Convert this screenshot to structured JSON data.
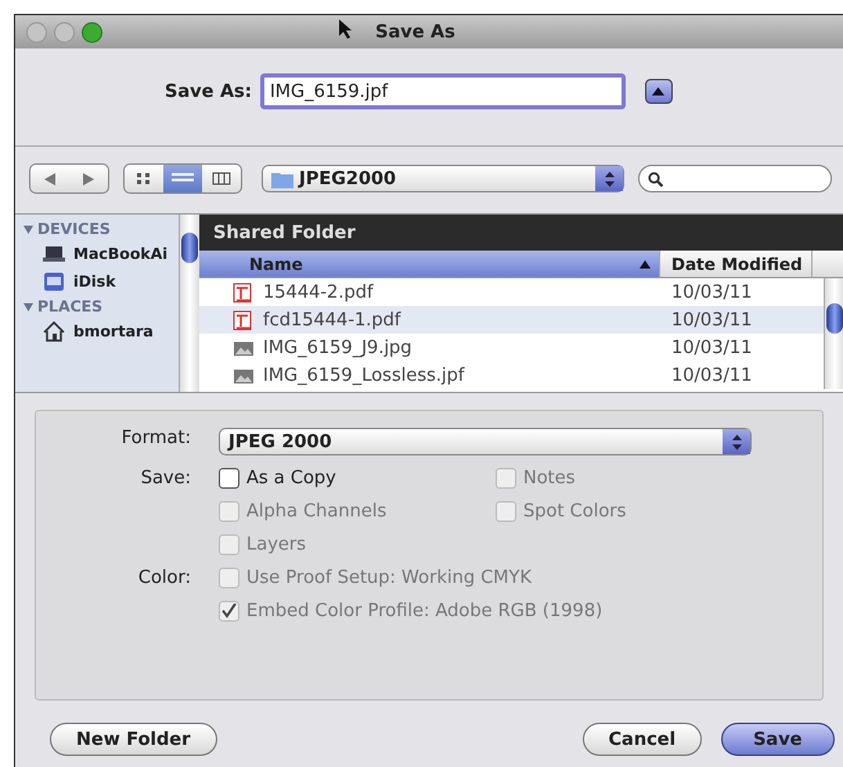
{
  "window": {
    "title": "Save As"
  },
  "save_as": {
    "label": "Save As:",
    "value": "IMG_6159.jpf",
    "expanded": false
  },
  "toolbar": {
    "views": [
      {
        "kind": "icon",
        "selected": false
      },
      {
        "kind": "list",
        "selected": true
      },
      {
        "kind": "column",
        "selected": false
      }
    ],
    "location": "JPEG2000"
  },
  "sidebar": {
    "sections": [
      {
        "title": "DEVICES",
        "items": [
          {
            "kind": "laptop",
            "label": "MacBookAi"
          },
          {
            "kind": "disk",
            "label": "iDisk"
          }
        ]
      },
      {
        "title": "PLACES",
        "items": [
          {
            "kind": "home",
            "label": "bmortara"
          }
        ]
      }
    ]
  },
  "browser": {
    "folder": "Shared Folder",
    "columns": [
      {
        "label": "Name",
        "sorted": true
      },
      {
        "label": "Date Modified",
        "sorted": false
      }
    ],
    "rows": [
      {
        "kind": "pdf",
        "name": "15444-2.pdf",
        "date": "10/03/11",
        "selected": false
      },
      {
        "kind": "pdf",
        "name": "fcd15444-1.pdf",
        "date": "10/03/11",
        "selected": true
      },
      {
        "kind": "image",
        "name": "IMG_6159_J9.jpg",
        "date": "10/03/11",
        "selected": false
      },
      {
        "kind": "image",
        "name": "IMG_6159_Lossless.jpf",
        "date": "10/03/11",
        "selected": false
      }
    ]
  },
  "options": {
    "format_label": "Format:",
    "format": "JPEG 2000",
    "rows": [
      {
        "label": "Save:",
        "boxes": [
          {
            "label": "As a Copy",
            "checked": false,
            "disabled": false
          },
          {
            "label": "Notes",
            "checked": false,
            "disabled": true
          }
        ]
      },
      {
        "label": "",
        "boxes": [
          {
            "label": "Alpha Channels",
            "checked": false,
            "disabled": true
          },
          {
            "label": "Spot Colors",
            "checked": false,
            "disabled": true
          }
        ]
      },
      {
        "label": "",
        "boxes": [
          {
            "label": "Layers",
            "checked": false,
            "disabled": true
          }
        ]
      },
      {
        "label": "Color:",
        "boxes": [
          {
            "label": "Use Proof Setup:  Working CMYK",
            "checked": false,
            "disabled": true
          }
        ]
      },
      {
        "label": "",
        "boxes": [
          {
            "label": "Embed Color Profile:  Adobe RGB (1998)",
            "checked": true,
            "disabled": true
          }
        ]
      }
    ]
  },
  "buttons": [
    {
      "kind": "plain",
      "label": "New Folder"
    },
    {
      "kind": "plain",
      "label": "Cancel"
    },
    {
      "kind": "default",
      "label": "Save"
    }
  ]
}
